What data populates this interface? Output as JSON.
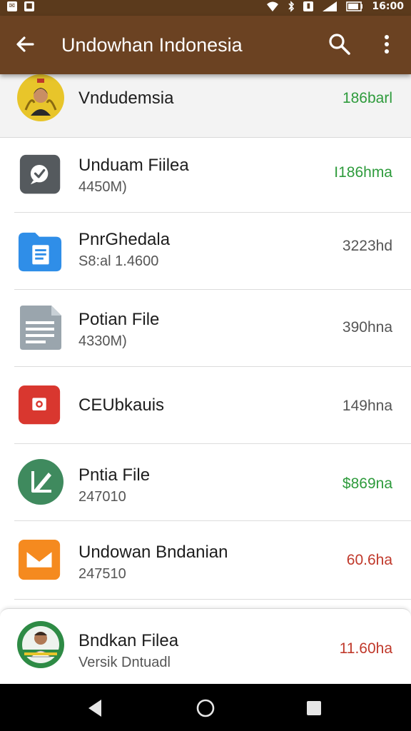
{
  "statusbar": {
    "time": "16:00",
    "left_icons": [
      "notification-icon",
      "notification-icon"
    ],
    "right_icons": [
      "wifi-icon",
      "bluetooth-icon",
      "sim-icon",
      "signal-icon",
      "battery-icon"
    ]
  },
  "toolbar": {
    "title": "Undowhan Indonesia",
    "back_icon": "arrow-left-icon",
    "search_icon": "search-icon",
    "more_icon": "more-vert-icon"
  },
  "items": [
    {
      "title": "Vndudemsia",
      "subtitle": "",
      "value": "186barl",
      "value_color": "#2e9b3c",
      "icon": "portrait-avatar-icon"
    },
    {
      "title": "Unduam Fiilea",
      "subtitle": "4450M)",
      "value": "I186hma",
      "value_color": "#2e9b3c",
      "icon": "chat-bubble-icon"
    },
    {
      "title": "PnrGhedala",
      "subtitle": "S8:al 1.4600",
      "value": "3223hd",
      "value_color": "#555555",
      "icon": "folder-icon"
    },
    {
      "title": "Potian File",
      "subtitle": "4330M)",
      "value": "390hna",
      "value_color": "#555555",
      "icon": "document-icon"
    },
    {
      "title": "CEUbkauis",
      "subtitle": "",
      "value": "149hna",
      "value_color": "#555555",
      "icon": "camera-icon"
    },
    {
      "title": "Pntia File",
      "subtitle": "247010",
      "value": "$869na",
      "value_color": "#2e9b3c",
      "icon": "edit-icon"
    },
    {
      "title": "Undowan Bndanian",
      "subtitle": "247510",
      "value": "60.6ha",
      "value_color": "#c0392b",
      "icon": "mail-icon"
    },
    {
      "title": "Bndkan Filea",
      "subtitle": "Versik Dntuadl",
      "value": "11.60ha",
      "value_color": "#c0392b",
      "icon": "portrait-avatar-icon"
    }
  ],
  "colors": {
    "toolbar": "#6b4222",
    "statusbar": "#5b3a1c",
    "green": "#2e9b3c",
    "red": "#c0392b"
  },
  "navbar": {
    "back_icon": "nav-back-icon",
    "home_icon": "nav-home-icon",
    "recents_icon": "nav-recents-icon"
  }
}
